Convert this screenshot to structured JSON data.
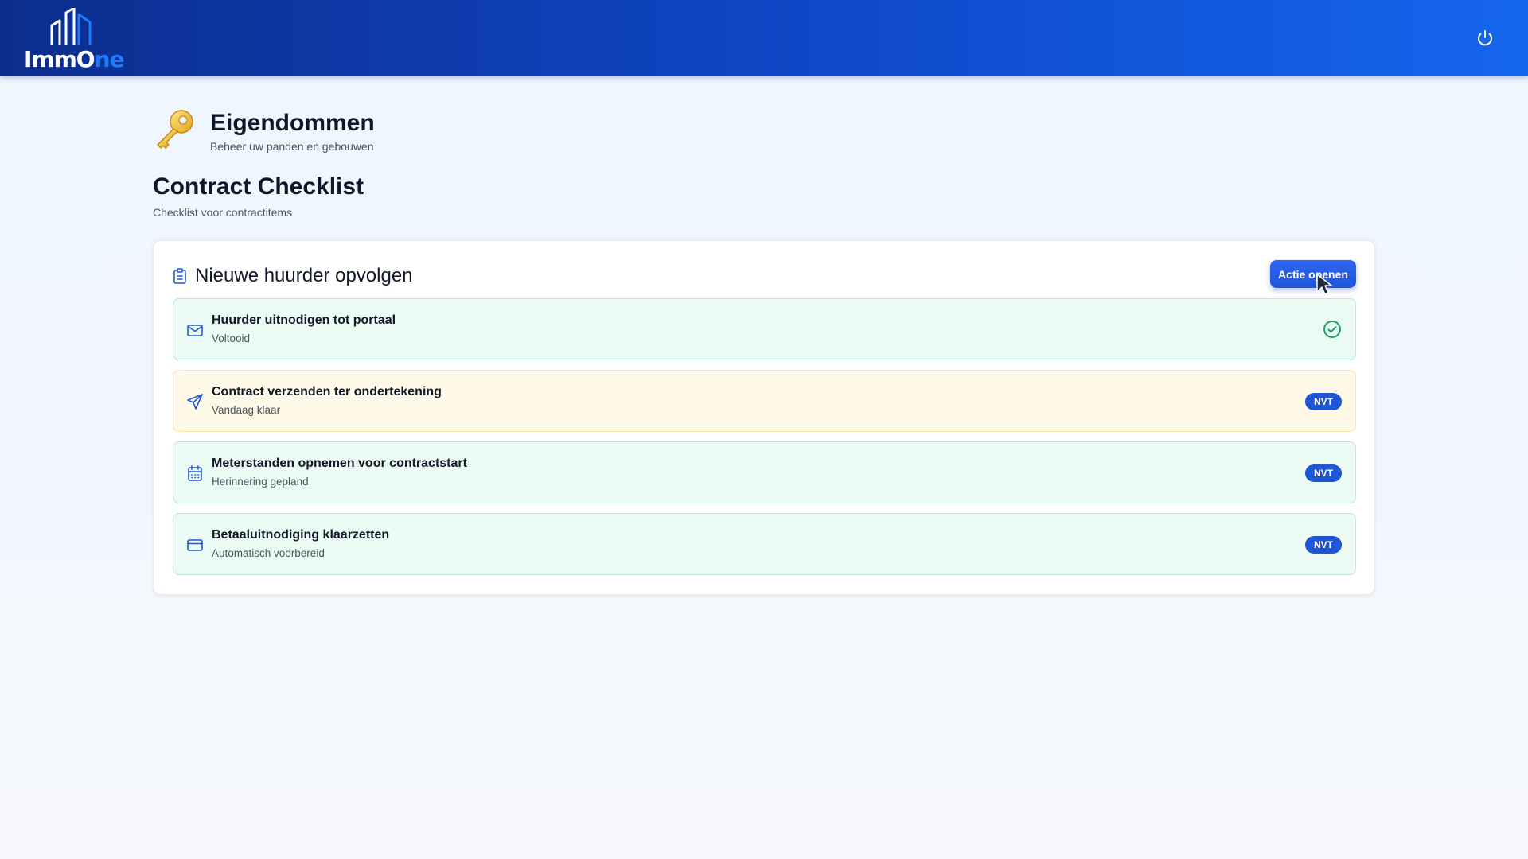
{
  "app": {
    "logo_text_main": "ImmO",
    "logo_text_accent": "ne",
    "power_icon": "power-icon"
  },
  "section": {
    "icon": "key-icon",
    "title": "Eigendommen",
    "subtitle": "Beheer uw panden en gebouwen"
  },
  "page": {
    "title": "Contract Checklist",
    "subtitle": "Checklist voor contractitems"
  },
  "card": {
    "icon": "clipboard-icon",
    "title": "Nieuwe huurder opvolgen",
    "action_label": "Actie openen"
  },
  "items": [
    {
      "icon": "mail-icon",
      "title": "Huurder uitnodigen tot portaal",
      "subtitle": "Voltooid",
      "status": "completed",
      "status_icon": "check-circle-icon"
    },
    {
      "icon": "send-icon",
      "title": "Contract verzenden ter ondertekening",
      "subtitle": "Vandaag klaar",
      "status": "NVT"
    },
    {
      "icon": "calendar-icon",
      "title": "Meterstanden opnemen voor contractstart",
      "subtitle": "Herinnering gepland",
      "status": "NVT"
    },
    {
      "icon": "credit-card-icon",
      "title": "Betaaluitnodiging klaarzetten",
      "subtitle": "Automatisch voorbereid",
      "status": "NVT"
    }
  ],
  "colors": {
    "header_start": "#0c2d8c",
    "header_end": "#1466ee",
    "accent": "#1f56d6",
    "success_bg": "#ebfaf3",
    "success_border": "#b7ecd3",
    "warning_bg": "#fff9e8",
    "warning_border": "#fde4a6",
    "success_icon": "#16a06a"
  }
}
